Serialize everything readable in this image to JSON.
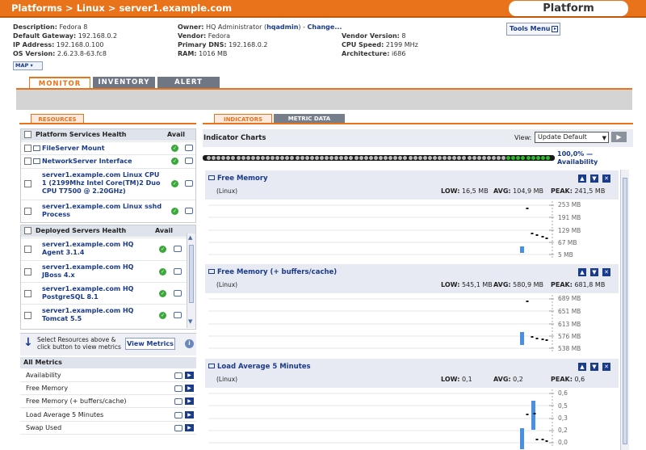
{
  "breadcrumb": {
    "p1": "Platforms",
    "sep": ">",
    "p2": "Linux",
    "p3": "server1.example.com"
  },
  "header_tag": "Platform",
  "resource_info": {
    "description": {
      "label": "Description:",
      "value": "Fedora 8"
    },
    "gateway": {
      "label": "Default Gateway:",
      "value": "192.168.0.2"
    },
    "ip": {
      "label": "IP Address:",
      "value": "192.168.0.100"
    },
    "os_version": {
      "label": "OS Version:",
      "value": "2.6.23.8-63.fc8"
    },
    "owner": {
      "label": "Owner:",
      "value": "HQ Administrator (",
      "username": "hqadmin",
      "close": ") -",
      "change": "Change..."
    },
    "vendor": {
      "label": "Vendor:",
      "value": "Fedora"
    },
    "dns": {
      "label": "Primary DNS:",
      "value": "192.168.0.2"
    },
    "ram": {
      "label": "RAM:",
      "value": "1016 MB"
    },
    "vendor_version": {
      "label": "Vendor Version:",
      "value": "8"
    },
    "cpu_speed": {
      "label": "CPU Speed:",
      "value": "2199 MHz"
    },
    "arch": {
      "label": "Architecture:",
      "value": "i686"
    }
  },
  "tools_menu": "Tools Menu",
  "map_button": "MAP",
  "tabs": {
    "monitor": "MONITOR",
    "inventory": "INVENTORY",
    "alert": "ALERT"
  },
  "subtabs": {
    "resources": "RESOURCES",
    "indicators": "INDICATORS",
    "metric_data": "METRIC DATA"
  },
  "platform_services": {
    "title": "Platform Services Health",
    "avail": "Avail",
    "items": [
      {
        "label": "FileServer Mount"
      },
      {
        "label": "NetworkServer Interface"
      },
      {
        "label": "server1.example.com Linux CPU 1 (2199Mhz Intel Core(TM)2 Duo CPU T7500 @ 2.20GHz)"
      },
      {
        "label": "server1.example.com Linux sshd Process"
      }
    ]
  },
  "deployed_servers": {
    "title": "Deployed Servers Health",
    "avail": "Avail",
    "items": [
      {
        "label": "server1.example.com HQ Agent 3.1.4"
      },
      {
        "label": "server1.example.com HQ JBoss 4.x"
      },
      {
        "label": "server1.example.com HQ PostgreSQL 8.1"
      },
      {
        "label": "server1.example.com HQ Tomcat 5.5"
      }
    ]
  },
  "select_hint": "Select Resources above & click button to view metrics",
  "view_metrics": "View Metrics",
  "all_metrics": {
    "title": "All Metrics",
    "items": [
      "Availability",
      "Free Memory",
      "Free Memory (+ buffers/cache)",
      "Load Average 5 Minutes",
      "Swap Used"
    ]
  },
  "indicator": {
    "title": "Indicator Charts",
    "view_label": "View:",
    "view_value": "Update Default",
    "availability_pct": "100,0% —",
    "availability_label": "Availability"
  },
  "charts": [
    {
      "name": "Free Memory",
      "sub": "(Linux)",
      "low_label": "LOW:",
      "low": "16,5 MB",
      "avg_label": "AVG:",
      "avg": "104,9 MB",
      "peak_label": "PEAK:",
      "peak": "241,5 MB",
      "yticks": [
        "253 MB",
        "191 MB",
        "129 MB",
        "67 MB",
        "5 MB"
      ]
    },
    {
      "name": "Free Memory (+ buffers/cache)",
      "sub": "(Linux)",
      "low_label": "LOW:",
      "low": "545,1 MB",
      "avg_label": "AVG:",
      "avg": "580,9 MB",
      "peak_label": "PEAK:",
      "peak": "681,8 MB",
      "yticks": [
        "689 MB",
        "651 MB",
        "613 MB",
        "576 MB",
        "538 MB"
      ]
    },
    {
      "name": "Load Average 5 Minutes",
      "sub": "(Linux)",
      "low_label": "LOW:",
      "low": "0,1",
      "avg_label": "AVG:",
      "avg": "0,2",
      "peak_label": "PEAK:",
      "peak": "0,6",
      "yticks": [
        "0,6",
        "0,5",
        "0,3",
        "0,2",
        "0,0"
      ]
    }
  ],
  "availability_dots": {
    "total": 70,
    "green_from": 61
  },
  "colors": {
    "accent": "#e8731a",
    "link": "#1a3a8a",
    "ok": "#3aa83a",
    "avail_green": "#2db82d",
    "bar": "#4a90e2"
  }
}
